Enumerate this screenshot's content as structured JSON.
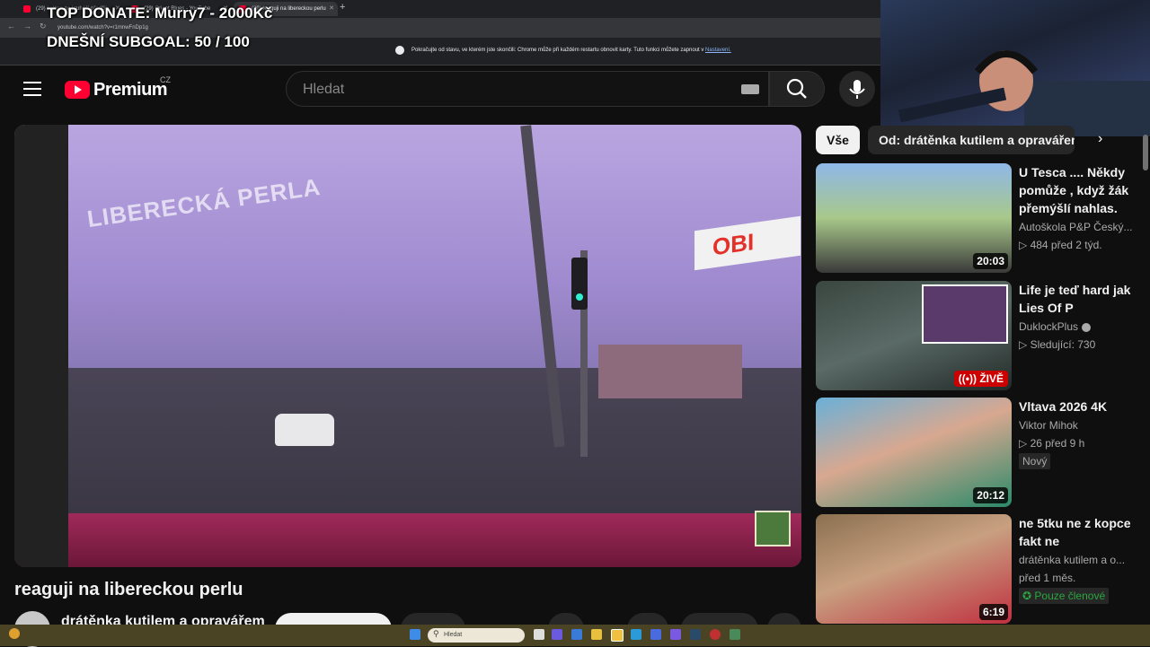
{
  "browser": {
    "tabs": [
      {
        "label": "(29) kolona na kruháči předčil..."
      },
      {
        "label": "(29) Orient Blues - YouTube"
      },
      {
        "label": "(29) reaguji na libereckou perlu"
      }
    ],
    "url": "youtube.com/watch?v=r1mnwFnDp1g",
    "infobar_text": "Pokračujte od stavu, ve kterém jste skončili: Chrome může při každém restartu obnovit karty. Tuto funkci můžete zapnout v",
    "infobar_link": "Nastavení."
  },
  "overlay": {
    "donate": "TOP DONATE: Murry7 - 2000Kč",
    "subgoal": "DNEŠNÍ SUBGOAL:  50 / 100"
  },
  "masthead": {
    "logo_text": "Premium",
    "country": "CZ",
    "search_placeholder": "Hledat"
  },
  "video": {
    "watermark": "LIBERECKÁ PERLA",
    "sign_text": "OBI",
    "title": "reaguji na libereckou perlu",
    "channel": "drátěnka kutilem a opravářem"
  },
  "chips": {
    "all": "Vše",
    "channel": "Od: drátěnka kutilem a opravářem"
  },
  "recommendations": [
    {
      "title": "U Tesca .... Někdy pomůže , když  žák přemýšlí nahlas.",
      "channel": "Autoškola P&P Český...",
      "stats": "▷ 484  před 2 týd.",
      "duration": "20:03"
    },
    {
      "title": "Life je teď hard jak Lies Of P",
      "channel": "DuklockPlus",
      "stats": "▷ Sledující: 730",
      "live": "((•)) ŽIVĚ"
    },
    {
      "title": "Vltava 2026 4K",
      "channel": "Viktor Mihok",
      "stats": "▷ 26  před 9 h",
      "badge": "Nový",
      "duration": "20:12"
    },
    {
      "title": "ne 5tku ne z kopce fakt ne",
      "channel": "drátěnka kutilem a o...",
      "stats": "před 1 měs.",
      "members": "Pouze členové",
      "duration": "6:19"
    }
  ],
  "taskbar": {
    "search": "Hledat"
  },
  "colors": {
    "brand_red": "#ff0033",
    "background": "#0f0f0f",
    "members_green": "#2ba640"
  }
}
